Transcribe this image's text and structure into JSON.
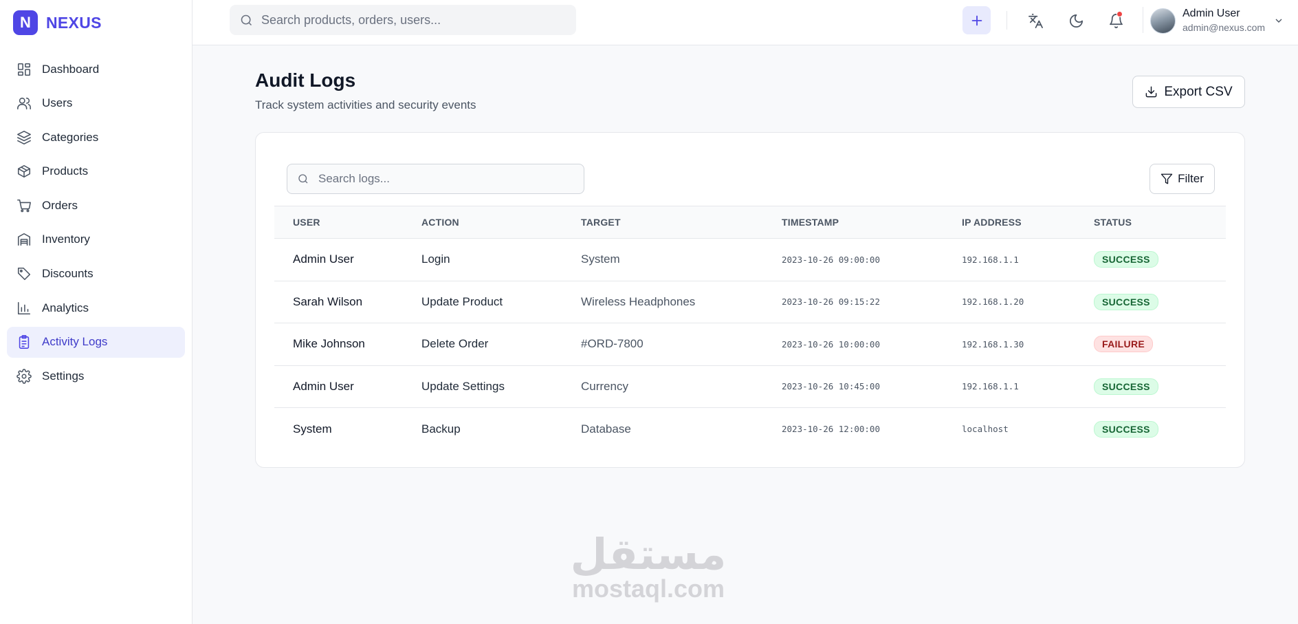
{
  "brand": {
    "logo_letter": "N",
    "name": "NEXUS",
    "accent": "#4f46e5"
  },
  "sidebar": {
    "items": [
      {
        "label": "Dashboard",
        "icon": "dashboard-icon",
        "active": false
      },
      {
        "label": "Users",
        "icon": "users-icon",
        "active": false
      },
      {
        "label": "Categories",
        "icon": "layers-icon",
        "active": false
      },
      {
        "label": "Products",
        "icon": "box-icon",
        "active": false
      },
      {
        "label": "Orders",
        "icon": "cart-icon",
        "active": false
      },
      {
        "label": "Inventory",
        "icon": "warehouse-icon",
        "active": false
      },
      {
        "label": "Discounts",
        "icon": "tag-icon",
        "active": false
      },
      {
        "label": "Analytics",
        "icon": "bar-chart-icon",
        "active": false
      },
      {
        "label": "Activity Logs",
        "icon": "clipboard-icon",
        "active": true
      },
      {
        "label": "Settings",
        "icon": "gear-icon",
        "active": false
      }
    ]
  },
  "header": {
    "search_placeholder": "Search products, orders, users...",
    "add_icon": "plus-icon",
    "icons": [
      "translate-icon",
      "moon-icon",
      "bell-icon"
    ],
    "notification_dot_color": "#ef4444",
    "user": {
      "name": "Admin User",
      "email": "admin@nexus.com"
    }
  },
  "main": {
    "title": "Audit Logs",
    "subtitle": "Track system activities and security events",
    "export_label": "Export CSV",
    "search_placeholder": "Search logs...",
    "filter_label": "Filter",
    "table": {
      "columns": [
        "USER",
        "ACTION",
        "TARGET",
        "TIMESTAMP",
        "IP ADDRESS",
        "STATUS"
      ],
      "rows": [
        {
          "user": "Admin User",
          "action": "Login",
          "target": "System",
          "timestamp": "2023-10-26 09:00:00",
          "ip": "192.168.1.1",
          "status": "SUCCESS"
        },
        {
          "user": "Sarah Wilson",
          "action": "Update Product",
          "target": "Wireless Headphones",
          "timestamp": "2023-10-26 09:15:22",
          "ip": "192.168.1.20",
          "status": "SUCCESS"
        },
        {
          "user": "Mike Johnson",
          "action": "Delete Order",
          "target": "#ORD-7800",
          "timestamp": "2023-10-26 10:00:00",
          "ip": "192.168.1.30",
          "status": "FAILURE"
        },
        {
          "user": "Admin User",
          "action": "Update Settings",
          "target": "Currency",
          "timestamp": "2023-10-26 10:45:00",
          "ip": "192.168.1.1",
          "status": "SUCCESS"
        },
        {
          "user": "System",
          "action": "Backup",
          "target": "Database",
          "timestamp": "2023-10-26 12:00:00",
          "ip": "localhost",
          "status": "SUCCESS"
        }
      ]
    }
  },
  "watermark": {
    "arabic": "مستقل",
    "latin": "mostaql.com"
  }
}
